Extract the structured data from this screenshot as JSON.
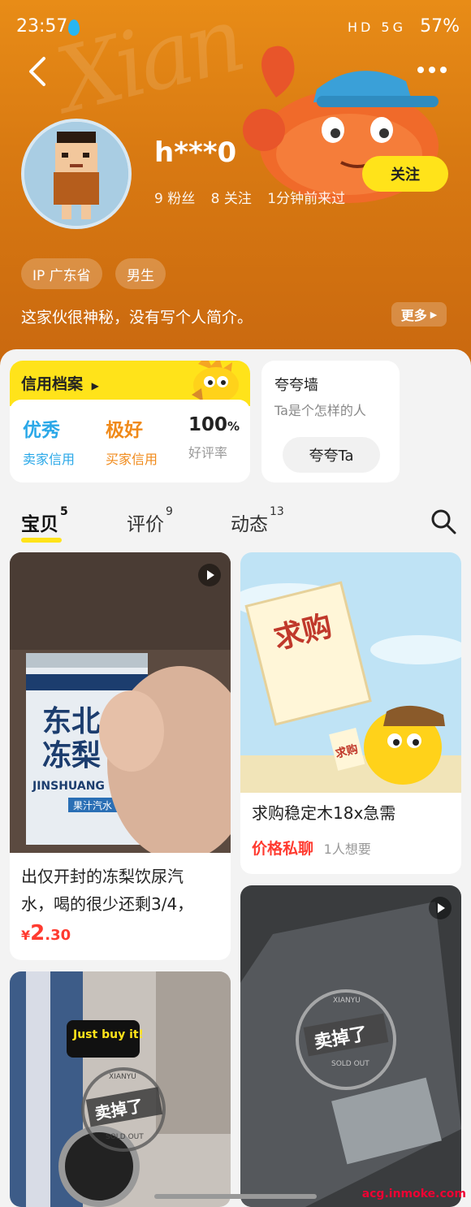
{
  "status_bar": {
    "time": "23:57",
    "icons": "HD 5G",
    "battery": "57%"
  },
  "header": {
    "bg_text": "Xian",
    "username": "h***0",
    "stats": {
      "fans": "9 粉丝",
      "following": "8 关注",
      "last_seen": "1分钟前来过"
    },
    "follow_label": "关注",
    "tags": [
      "IP 广东省",
      "男生"
    ],
    "bio": "这家伙很神秘，没有写个人简介。",
    "more_label": "更多"
  },
  "credit": {
    "title": "信用档案",
    "metrics": [
      {
        "value": "优秀",
        "label": "卖家信用",
        "color": "#2aa8e8"
      },
      {
        "value": "极好",
        "label": "买家信用",
        "color": "#f08a1a"
      },
      {
        "value": "100",
        "suffix": "%",
        "label": "好评率",
        "color": "#222222"
      }
    ]
  },
  "praise": {
    "title": "夸夸墙",
    "subtitle": "Ta是个怎样的人",
    "button": "夸夸Ta"
  },
  "tabs": [
    {
      "label": "宝贝",
      "count": "5"
    },
    {
      "label": "评价",
      "count": "9"
    },
    {
      "label": "动态",
      "count": "13"
    }
  ],
  "items": [
    {
      "title_line1": "出仅开封的冻梨饮尿汽",
      "title_line2": "水，喝的很少还剩3/4，",
      "price_symbol": "¥",
      "price_int": "2",
      "price_dec": ".30",
      "can_text1": "东北",
      "can_text2": "冻梨",
      "can_brand": "JINSHUANG",
      "can_flavor": "果汁汽水"
    },
    {
      "title": "求购稳定木18x急需",
      "price_label": "价格私聊",
      "wants": "1人想要",
      "sign_text": "求购",
      "small_sign": "求购"
    },
    {
      "stamp": "卖掉了",
      "stamp_sub": "SOLD OUT",
      "sticker": "Just buy it!",
      "stamp_top": "XIANYU"
    },
    {
      "stamp": "卖掉了",
      "stamp_sub": "SOLD OUT",
      "stamp_top": "XIANYU"
    }
  ],
  "watermark": "acg.inmoke.com"
}
